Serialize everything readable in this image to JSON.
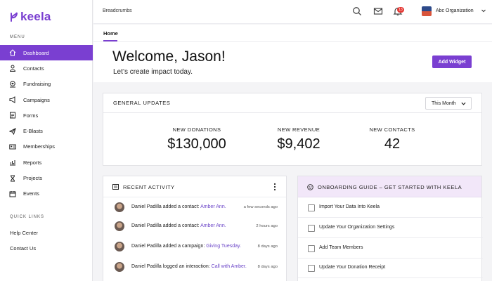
{
  "brand": {
    "name": "keela",
    "color": "#7a3fd1"
  },
  "sidebar": {
    "menu_heading": "MENU",
    "items": [
      {
        "label": "Dashboard",
        "icon": "home-icon",
        "active": true
      },
      {
        "label": "Contacts",
        "icon": "person-icon"
      },
      {
        "label": "Fundraising",
        "icon": "hand-heart-icon"
      },
      {
        "label": "Campaigns",
        "icon": "megaphone-icon"
      },
      {
        "label": "Forms",
        "icon": "form-icon"
      },
      {
        "label": "E-Blasts",
        "icon": "paper-plane-icon"
      },
      {
        "label": "Memberships",
        "icon": "id-card-icon"
      },
      {
        "label": "Reports",
        "icon": "bar-chart-icon"
      },
      {
        "label": "Projects",
        "icon": "hourglass-icon"
      },
      {
        "label": "Events",
        "icon": "calendar-icon"
      }
    ],
    "quick_links_heading": "QUICK LINKS",
    "quick_links": [
      {
        "label": "Help Center"
      },
      {
        "label": "Contact Us"
      }
    ]
  },
  "topbar": {
    "breadcrumbs": "Breadcrumbs",
    "notifications_count": "13",
    "org_name": "Abc Organization"
  },
  "home": {
    "tab_label": "Home",
    "welcome": "Welcome, Jason!",
    "subtitle": "Let’s create impact today.",
    "add_widget_label": "Add Widget"
  },
  "general_updates": {
    "title": "GENERAL UPDATES",
    "period": "This Month",
    "stats": [
      {
        "label": "NEW DONATIONS",
        "value": "$130,000"
      },
      {
        "label": "NEW REVENUE",
        "value": "$9,402"
      },
      {
        "label": "NEW CONTACTS",
        "value": "42"
      }
    ]
  },
  "recent_activity": {
    "title": "RECENT ACTIVITY",
    "rows": [
      {
        "text": "Daniel Padilla added a contact: ",
        "link": "Amber Ann.",
        "time": "a few seconds ago"
      },
      {
        "text": "Daniel Padilla added a contact: ",
        "link": "Amber Ann.",
        "time": "2 hours ago"
      },
      {
        "text": "Daniel Padilla added a campaign: ",
        "link": "Giving Tuesday.",
        "time": "8 days ago"
      },
      {
        "text": "Daniel Padilla logged an interaction: ",
        "link": "Call with Amber.",
        "time": "8 days ago"
      }
    ]
  },
  "onboarding": {
    "title": "ONBOARDING GUIDE – GET STARTED WITH KEELA",
    "items": [
      {
        "label": "Import Your Data Into Keela"
      },
      {
        "label": "Update Your Organization Settings"
      },
      {
        "label": "Add Team Members"
      },
      {
        "label": "Update Your Donation Receipt"
      }
    ]
  }
}
